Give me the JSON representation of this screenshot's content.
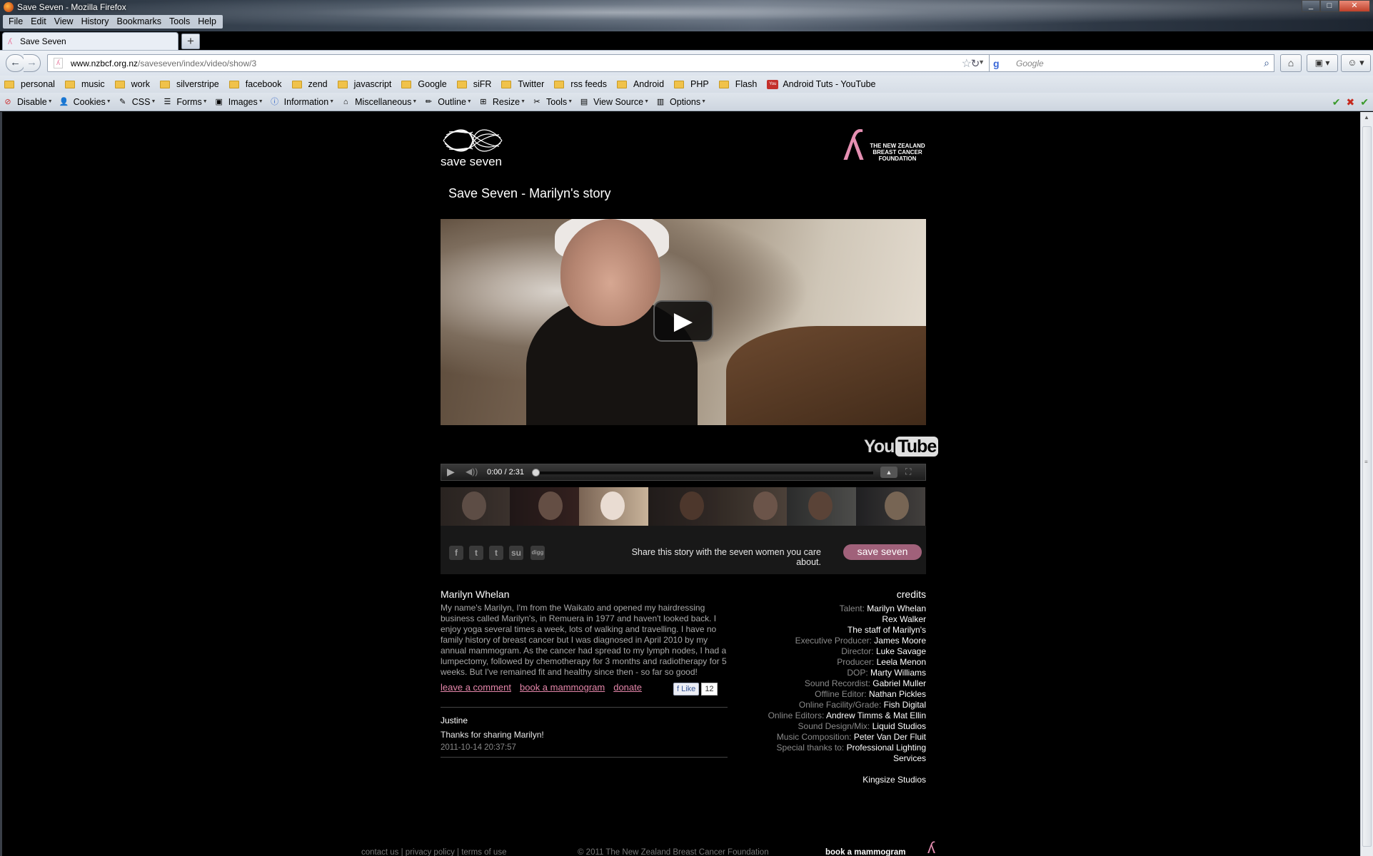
{
  "window": {
    "title": "Save Seven - Mozilla Firefox",
    "menu": [
      "File",
      "Edit",
      "View",
      "History",
      "Bookmarks",
      "Tools",
      "Help"
    ],
    "buttons": [
      "minimize",
      "maximize",
      "close"
    ]
  },
  "tabs": [
    {
      "label": "Save Seven",
      "active": true
    }
  ],
  "new_tab_label": "+",
  "navigation": {
    "url_domain": "www.nzbcf.org.nz",
    "url_path": "/saveseven/index/video/show/3",
    "search_placeholder": "Google"
  },
  "bookmarks": [
    {
      "label": "personal",
      "icon": "folder-icon"
    },
    {
      "label": "music",
      "icon": "folder-icon"
    },
    {
      "label": "work",
      "icon": "folder-icon"
    },
    {
      "label": "silverstripe",
      "icon": "folder-icon"
    },
    {
      "label": "facebook",
      "icon": "folder-icon"
    },
    {
      "label": "zend",
      "icon": "folder-icon"
    },
    {
      "label": "javascript",
      "icon": "folder-icon"
    },
    {
      "label": "Google",
      "icon": "folder-icon"
    },
    {
      "label": "siFR",
      "icon": "folder-icon"
    },
    {
      "label": "Twitter",
      "icon": "folder-icon"
    },
    {
      "label": "rss feeds",
      "icon": "folder-icon"
    },
    {
      "label": "Android",
      "icon": "folder-icon"
    },
    {
      "label": "PHP",
      "icon": "folder-icon"
    },
    {
      "label": "Flash",
      "icon": "folder-icon"
    },
    {
      "label": "Android Tuts - YouTube",
      "icon": "youtube-icon"
    }
  ],
  "devtools": [
    "Disable",
    "Cookies",
    "CSS",
    "Forms",
    "Images",
    "Information",
    "Miscellaneous",
    "Outline",
    "Resize",
    "Tools",
    "View Source",
    "Options"
  ],
  "page": {
    "logo_text": "save seven",
    "nzbcf_logo_text": "THE NEW ZEALAND BREAST CANCER FOUNDATION",
    "title": "Save Seven - Marilyn's story",
    "youtube_logo": {
      "you": "You",
      "tube": "Tube"
    },
    "player": {
      "time": "0:00 / 2:31",
      "progress": 0
    },
    "thumbnails_count": 7,
    "active_thumbnail": 2,
    "share": {
      "icons": [
        "facebook-icon",
        "twitter-icon",
        "tumblr-icon",
        "stumbleupon-icon",
        "digg-icon"
      ],
      "text": "Share this story with the seven women you care about.",
      "button": "save seven"
    },
    "person": {
      "name": "Marilyn Whelan",
      "bio": "My name's Marilyn, I'm from the Waikato and opened my hairdressing business called Marilyn's, in Remuera in 1977 and haven't looked back. I enjoy yoga several times a week, lots of walking and travelling. I have no family history of breast cancer but I was diagnosed in April 2010 by my annual mammogram. As the cancer had spread to my lymph nodes, I had a lumpectomy, followed by chemotherapy for 3 months and radiotherapy for 5 weeks. But I've remained fit and healthy since then - so far so good!"
    },
    "links": [
      "leave a comment",
      "book a mammogram",
      "donate"
    ],
    "fb_like": {
      "label": "Like",
      "count": "12"
    },
    "comment": {
      "author": "Justine",
      "text": "Thanks for sharing Marilyn!",
      "date": "2011-10-14 20:37:57"
    },
    "credits": {
      "title": "credits",
      "rows": [
        {
          "key": "Talent:",
          "value": "Marilyn Whelan"
        },
        {
          "key": "",
          "value": "Rex Walker"
        },
        {
          "key": "",
          "value": "The staff of Marilyn's"
        },
        {
          "key": "Executive Producer:",
          "value": "James Moore"
        },
        {
          "key": "Director:",
          "value": "Luke Savage"
        },
        {
          "key": "Producer:",
          "value": "Leela Menon"
        },
        {
          "key": "DOP:",
          "value": "Marty Williams"
        },
        {
          "key": "Sound Recordist:",
          "value": "Gabriel Muller"
        },
        {
          "key": "Offline Editor:",
          "value": "Nathan Pickles"
        },
        {
          "key": "Online Facility/Grade:",
          "value": "Fish Digital"
        },
        {
          "key": "Online Editors:",
          "value": "Andrew Timms & Mat Ellin"
        },
        {
          "key": "Sound Design/Mix:",
          "value": "Liquid Studios"
        },
        {
          "key": "Music Composition:",
          "value": "Peter Van Der Fluit"
        },
        {
          "key": "Special thanks to:",
          "value": "Professional Lighting"
        },
        {
          "key": "",
          "value": "Services"
        }
      ],
      "extra": "Kingsize Studios"
    },
    "footer": {
      "links": "contact us  |  privacy policy  |  terms of use",
      "copyright": "© 2011 The New Zealand Breast Cancer Foundation",
      "book": "book a mammogram"
    }
  }
}
